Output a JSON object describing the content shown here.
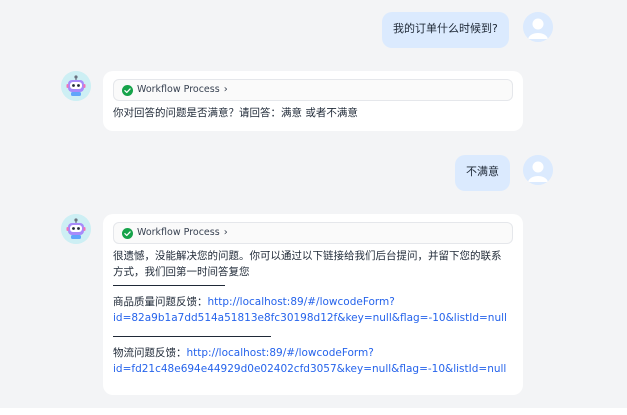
{
  "messages": [
    {
      "role": "user",
      "text": "我的订单什么时候到?"
    },
    {
      "role": "bot",
      "workflow_label": "Workflow Process",
      "text": "你对回答的问题是否满意？请回答：满意 或者不满意"
    },
    {
      "role": "user",
      "text": "不满意"
    },
    {
      "role": "bot",
      "workflow_label": "Workflow Process",
      "text": "很遗憾，没能解决您的问题。你可以通过以下链接给我们后台提问，并留下您的联系方式，我们回第一时间答复您",
      "feedback": [
        {
          "label": "商品质量问题反馈：",
          "url_line1": "http://localhost:89/#/lowcodeForm?",
          "url_line2": "id=82a9b1a7dd514a51813e8fc30198d12f&key=null&flag=-10&listId=null"
        },
        {
          "label": "物流问题反馈：",
          "url_line1": "http://localhost:89/#/lowcodeForm?",
          "url_line2": "id=fd21c48e694e44929d0e02402cfd3057&key=null&flag=-10&listId=null"
        }
      ]
    }
  ],
  "icons": {
    "workflow_status": "check-circle-icon",
    "workflow_expand": "chevron-right-icon",
    "user_avatar": "user-avatar",
    "bot_avatar": "robot-avatar"
  },
  "colors": {
    "page_bg": "#f3f4f6",
    "user_bubble": "#dbeafe",
    "bot_bubble": "#ffffff",
    "link": "#2563eb",
    "success": "#16a34a"
  }
}
